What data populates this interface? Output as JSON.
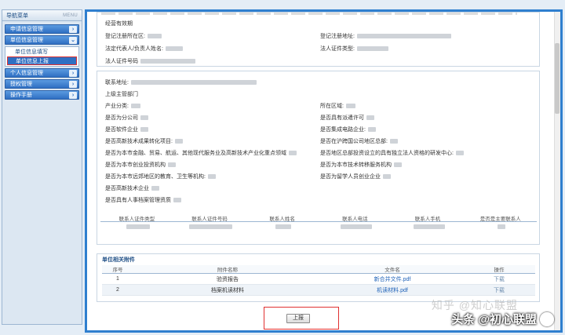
{
  "sidebar": {
    "title": "导航菜单",
    "menu_label": "MENU",
    "items": [
      {
        "label": "申请信息管理"
      },
      {
        "label": "单位信息管理"
      },
      {
        "label": "个人信息管理"
      },
      {
        "label": "授权管理"
      },
      {
        "label": "操作手册"
      }
    ],
    "sub_items": [
      "单位信息填写",
      "单位信息上报"
    ]
  },
  "basic": {
    "validity_label": "经营有效期",
    "reg_area_label": "登记注册所在区:",
    "reg_addr_label": "登记注册地址:",
    "legal_rep_label": "法定代表人/负责人姓名:",
    "legal_id_type_label": "法人证件类型:",
    "legal_id_no_label": "法人证件号码"
  },
  "detail": {
    "contact_addr": "联系地址:",
    "superior_dept": "上级主管部门",
    "industry": "产业分类:",
    "region": "所在区域:",
    "branch": "是否为分公司",
    "dispatch_license": "是否具有派遣许可",
    "software": "是否软件企业",
    "ic": "是否集成电路企业:",
    "hitech_transform": "是否高新技术成果转化项目:",
    "hq": "是否在沪跨国公司地区总部:",
    "finance": "是否为本市金融、贸易、航运、其他现代服务业及高新技术产业化重点领域",
    "rd_center": "是否地区总部投资设立的具有独立法人资格的研发中心:",
    "vc": "是否为本市创业投资机构",
    "tech_transfer": "是否为本市技术转移服务机构",
    "suburb": "是否为本市远郊地区的教育、卫生等机构:",
    "returnee": "是否为留学人员创业企业",
    "hitech": "是否高新技术企业",
    "hr_archive": "是否具有人事档案管理资质"
  },
  "contact_table": {
    "headers": [
      "联系人证件类型",
      "联系人证件号码",
      "联系人姓名",
      "联系人电话",
      "联系人手机",
      "是否是主要联系人"
    ]
  },
  "attachments": {
    "title": "单位相关附件",
    "headers": [
      "序号",
      "附件名称",
      "文件名",
      "操作"
    ],
    "rows": [
      {
        "no": "1",
        "name": "验资报告",
        "file": "新合并文件.pdf",
        "action": "下载"
      },
      {
        "no": "2",
        "name": "档案机读材料",
        "file": "机读材料.pdf",
        "action": "下载"
      }
    ]
  },
  "submit_label": "上报",
  "watermark": {
    "faint": "知乎 @知心联盟",
    "main": "头条 @初心联盟"
  }
}
